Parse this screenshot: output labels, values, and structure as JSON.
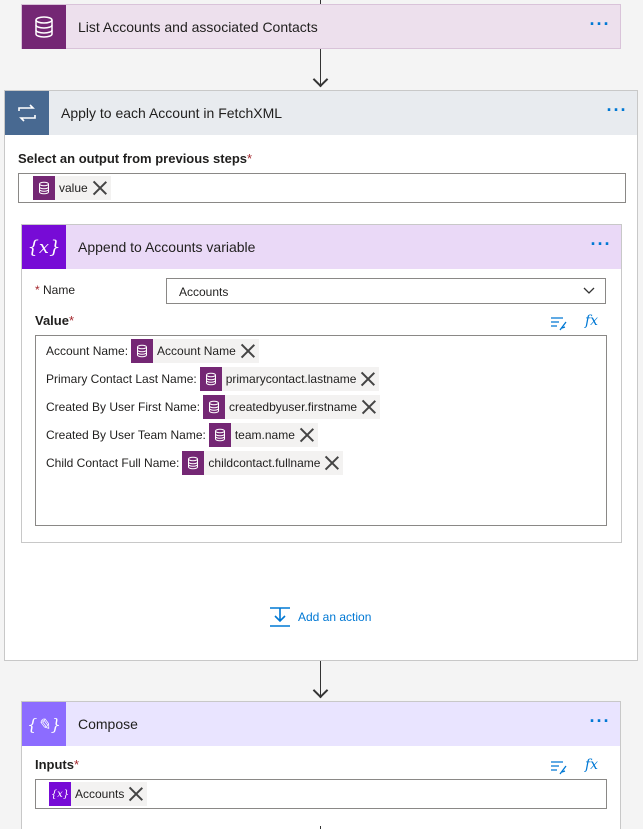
{
  "list_accounts": {
    "title": "List Accounts and associated Contacts",
    "more": "···"
  },
  "apply_each": {
    "title": "Apply to each Account in FetchXML",
    "more": "···",
    "select_label": "Select an output from previous steps",
    "required": "*",
    "token": "value",
    "add_action": "Add an action"
  },
  "append": {
    "title": "Append to Accounts variable",
    "more": "···",
    "name_label": "Name",
    "name_value": "Accounts",
    "value_label": "Value",
    "required": "*",
    "fx": "fx",
    "lines": [
      {
        "prefix": "Account Name:",
        "token": "Account Name"
      },
      {
        "prefix": "Primary Contact Last Name:",
        "token": "primarycontact.lastname"
      },
      {
        "prefix": "Created By User First Name:",
        "token": "createdbyuser.firstname"
      },
      {
        "prefix": "Created By User Team Name:",
        "token": "team.name"
      },
      {
        "prefix": "Child Contact Full Name:",
        "token": "childcontact.fullname"
      }
    ]
  },
  "compose": {
    "title": "Compose",
    "more": "···",
    "inputs_label": "Inputs",
    "required": "*",
    "fx": "fx",
    "token": "Accounts"
  },
  "colors": {
    "dataverse": "#742774",
    "variable": "#770bd6",
    "compose": "#8c6cff",
    "loop": "#486991",
    "accent": "#0078d4"
  }
}
